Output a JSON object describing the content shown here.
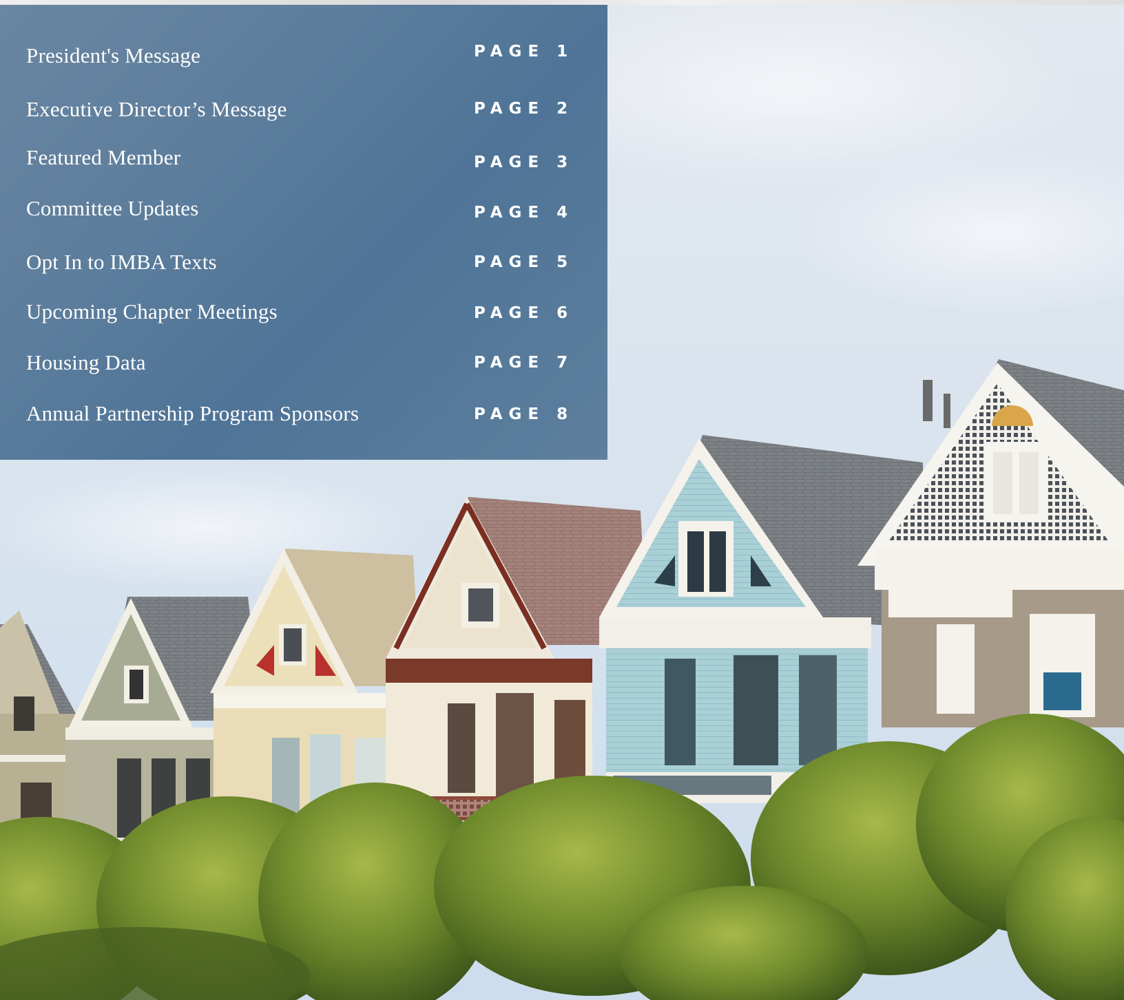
{
  "toc": {
    "items": [
      {
        "title": "President's Message",
        "page_label": "PAGE",
        "page_number": "1"
      },
      {
        "title": "Executive Director’s Message",
        "page_label": "PAGE",
        "page_number": "2"
      },
      {
        "title": "Featured Member",
        "page_label": "PAGE",
        "page_number": "3"
      },
      {
        "title": "Committee Updates",
        "page_label": "PAGE",
        "page_number": "4"
      },
      {
        "title": "Opt In to IMBA Texts",
        "page_label": "PAGE",
        "page_number": "5"
      },
      {
        "title": "Upcoming Chapter Meetings",
        "page_label": "PAGE",
        "page_number": "6"
      },
      {
        "title": "Housing Data",
        "page_label": "PAGE",
        "page_number": "7"
      },
      {
        "title": "Annual Partnership Program Sponsors",
        "page_label": "PAGE",
        "page_number": "8"
      }
    ]
  },
  "colors": {
    "panel": "#5b7c9b",
    "sky": "#dfe6ee",
    "text": "#ffffff"
  }
}
